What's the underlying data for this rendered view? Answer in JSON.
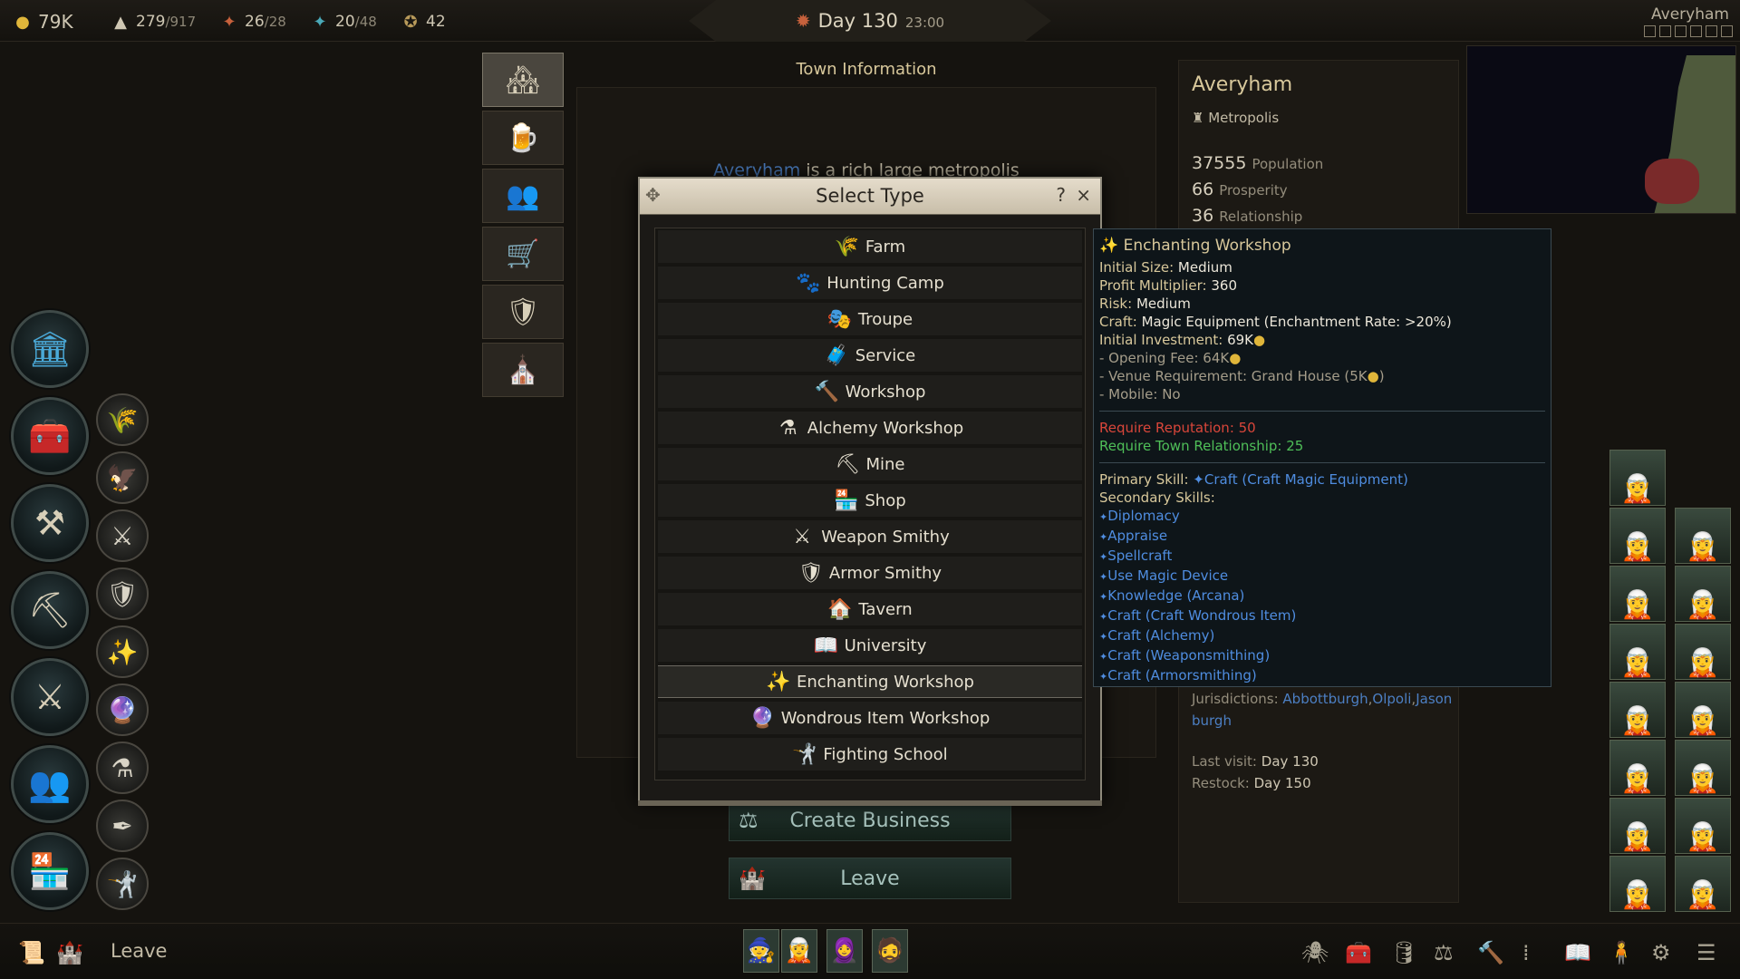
{
  "top": {
    "gold": "79K",
    "party": {
      "cur": "279",
      "max": "/917"
    },
    "food": {
      "cur": "26",
      "max": "/28"
    },
    "morale": {
      "cur": "20",
      "max": "/48"
    },
    "reputation": "42",
    "day": "Day 130",
    "time": "23:00",
    "location": "Averyham"
  },
  "town_info": {
    "title": "Town Information",
    "desc_link": "Averyham",
    "desc_rest": " is a rich large metropolis"
  },
  "town_card": {
    "name": "Averyham",
    "type": "Metropolis",
    "population": "37555",
    "population_label": "Population",
    "prosperity": "66",
    "prosperity_label": "Prosperity",
    "relationship": "36",
    "relationship_label": "Relationship",
    "jurisdictions_label": "Jurisdictions:",
    "jurisdictions_1": "Abbottburgh",
    "jurisdictions_2": "Olpoli",
    "jurisdictions_3": "Jason",
    "jurisdictions_4": "burgh",
    "last_visit_label": "Last visit:",
    "last_visit": "Day 130",
    "restock_label": "Restock:",
    "restock": "Day 150"
  },
  "buttons": {
    "create_business": "Create Business",
    "leave": "Leave"
  },
  "dialog": {
    "title": "Select Type",
    "help": "?",
    "close": "×",
    "items": [
      {
        "label": "Farm",
        "icon": "🌾"
      },
      {
        "label": "Hunting Camp",
        "icon": "🐾"
      },
      {
        "label": "Troupe",
        "icon": "🎭"
      },
      {
        "label": "Service",
        "icon": "🧳"
      },
      {
        "label": "Workshop",
        "icon": "🔨"
      },
      {
        "label": "Alchemy Workshop",
        "icon": "⚗"
      },
      {
        "label": "Mine",
        "icon": "⛏"
      },
      {
        "label": "Shop",
        "icon": "🏪"
      },
      {
        "label": "Weapon Smithy",
        "icon": "⚔"
      },
      {
        "label": "Armor Smithy",
        "icon": "🛡"
      },
      {
        "label": "Tavern",
        "icon": "🏠"
      },
      {
        "label": "University",
        "icon": "📖"
      },
      {
        "label": "Enchanting Workshop",
        "icon": "✨"
      },
      {
        "label": "Wondrous Item Workshop",
        "icon": "🔮"
      },
      {
        "label": "Fighting School",
        "icon": "🤺"
      }
    ],
    "selected_index": 12
  },
  "tooltip": {
    "title": "Enchanting Workshop",
    "initial_size_label": "Initial Size:",
    "initial_size": "Medium",
    "profit_label": "Profit Multiplier:",
    "profit": "360",
    "risk_label": "Risk:",
    "risk": "Medium",
    "craft_label": "Craft:",
    "craft": "Magic Equipment (Enchantment Rate: >20%)",
    "investment_label": "Initial Investment:",
    "investment": "69K",
    "opening_fee": "- Opening Fee: 64K",
    "venue_req": "- Venue Requirement: Grand House (5K",
    "venue_req_end": ")",
    "mobile": "- Mobile: No",
    "req_reputation": "Require Reputation: 50",
    "req_relationship": "Require Town Relationship: 25",
    "primary_label": "Primary Skill:",
    "primary_skill": "Craft (Craft Magic Equipment)",
    "secondary_label": "Secondary Skills:",
    "secondary_skills": [
      "Diplomacy",
      "Appraise",
      "Spellcraft",
      "Use Magic Device",
      "Knowledge (Arcana)",
      "Craft (Craft Wondrous Item)",
      "Craft (Alchemy)",
      "Craft (Weaponsmithing)",
      "Craft (Armorsmithing)"
    ]
  },
  "bottom": {
    "leave": "Leave"
  },
  "colors": {
    "accent_gold": "#d8c89b",
    "link_blue": "#4f8de0",
    "req_red": "#d9463a",
    "req_green": "#4fbf58"
  }
}
